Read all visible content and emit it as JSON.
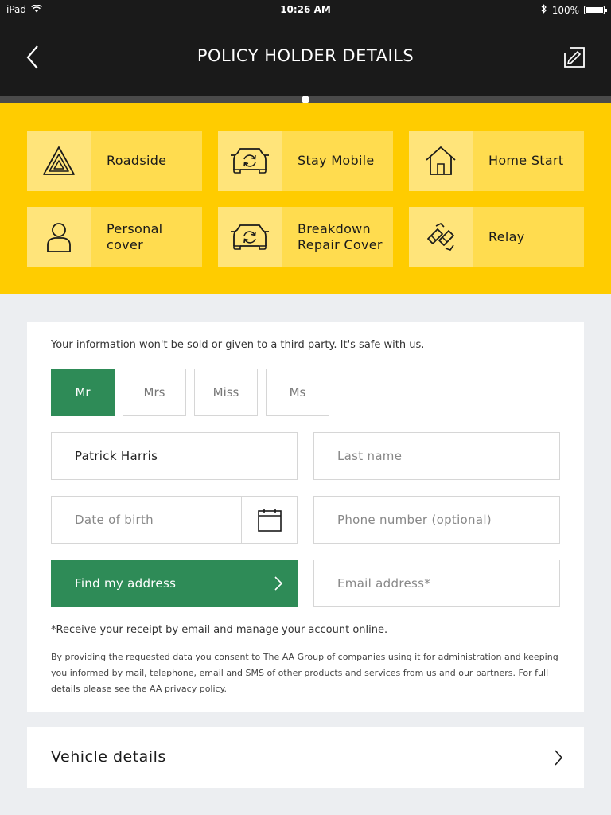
{
  "status_bar": {
    "device": "iPad",
    "time": "10:26 AM",
    "battery": "100%",
    "battery_level": 1.0
  },
  "nav": {
    "title": "POLICY HOLDER DETAILS",
    "back_icon": "chevron-left-icon",
    "edit_icon": "edit-icon"
  },
  "progress": {
    "step": 4,
    "total_steps": 7
  },
  "services": [
    {
      "label": "Roadside",
      "icon": "warning-triangle-icon"
    },
    {
      "label": "Stay Mobile",
      "icon": "car-refresh-icon"
    },
    {
      "label": "Home Start",
      "icon": "house-icon"
    },
    {
      "label": "Personal cover",
      "icon": "person-icon",
      "lines": [
        "Personal",
        "cover"
      ]
    },
    {
      "label": "Breakdown Repair Cover",
      "icon": "car-refresh-icon",
      "lines": [
        "Breakdown",
        "Repair Cover"
      ]
    },
    {
      "label": "Relay",
      "icon": "tow-hook-icon"
    }
  ],
  "form": {
    "privacy_note": "Your information won't be sold or given to a third party. It's safe with us.",
    "titles": [
      "Mr",
      "Mrs",
      "Miss",
      "Ms"
    ],
    "selected_title": "Mr",
    "first_name": {
      "value": "Patrick Harris"
    },
    "last_name": {
      "placeholder": "Last name"
    },
    "date_of_birth": {
      "placeholder": "Date of birth"
    },
    "phone": {
      "placeholder": "Phone number (optional)"
    },
    "email": {
      "placeholder": "Email address*"
    },
    "find_address_label": "Find my address",
    "receipt_note": "*Receive your receipt by email and manage your account online.",
    "consent": "By providing the requested data you consent to The AA Group of companies using it for administration and keeping you informed by mail, telephone, email and SMS of other products and services from us and our partners. For full details please see the AA privacy policy."
  },
  "vehicle": {
    "label": "Vehicle details"
  },
  "colors": {
    "accent_green": "#2e8b57",
    "brand_yellow": "#ffcc00",
    "nav_dark": "#1a1a1a"
  }
}
